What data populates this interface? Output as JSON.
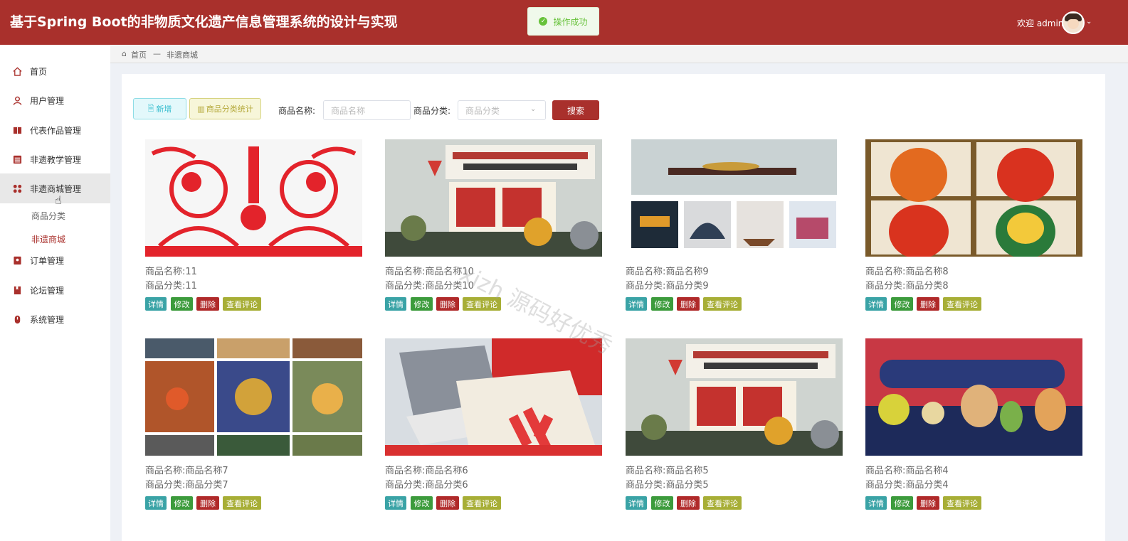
{
  "header": {
    "app_title": "基于Spring Boot的非物质文化遗产信息管理系统的设计与实现",
    "toast": "操作成功",
    "welcome": "欢迎 admin"
  },
  "breadcrumb": {
    "home": "首页",
    "separator": "—",
    "current": "非遗商城"
  },
  "sidebar": {
    "items": [
      {
        "label": "首页",
        "icon": "home-icon"
      },
      {
        "label": "用户管理",
        "icon": "user-icon"
      },
      {
        "label": "代表作品管理",
        "icon": "book-icon"
      },
      {
        "label": "非遗教学管理",
        "icon": "list-icon"
      },
      {
        "label": "非遗商城管理",
        "icon": "grid-icon"
      },
      {
        "label": "订单管理",
        "icon": "order-icon"
      },
      {
        "label": "论坛管理",
        "icon": "forum-icon"
      },
      {
        "label": "系统管理",
        "icon": "system-icon"
      }
    ],
    "subitems": [
      {
        "label": "商品分类"
      },
      {
        "label": "非遗商城"
      }
    ]
  },
  "toolbar": {
    "add_label": "新增",
    "stat_label": "商品分类统计",
    "name_label": "商品名称:",
    "name_placeholder": "商品名称",
    "cat_label": "商品分类:",
    "cat_placeholder": "商品分类",
    "search_label": "搜索"
  },
  "card_labels": {
    "name": "商品名称:",
    "category": "商品分类:"
  },
  "actions": {
    "detail": "详情",
    "edit": "修改",
    "delete": "删除",
    "comments": "查看评论"
  },
  "products": [
    {
      "name": "11",
      "category": "11"
    },
    {
      "name": "商品名称10",
      "category": "商品分类10"
    },
    {
      "name": "商品名称9",
      "category": "商品分类9"
    },
    {
      "name": "商品名称8",
      "category": "商品分类8"
    },
    {
      "name": "商品名称7",
      "category": "商品分类7"
    },
    {
      "name": "商品名称6",
      "category": "商品分类6"
    },
    {
      "name": "商品名称5",
      "category": "商品分类5"
    },
    {
      "name": "商品名称4",
      "category": "商品分类4"
    }
  ],
  "watermark": "xizh 源码好优秀",
  "colors": {
    "brand": "#a9302c"
  }
}
